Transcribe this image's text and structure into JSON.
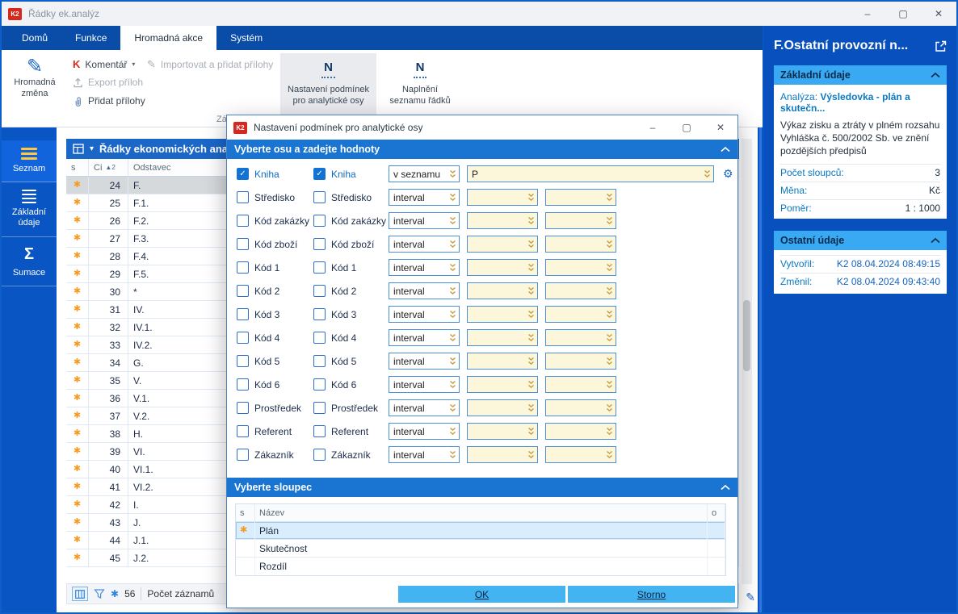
{
  "window": {
    "title": "Řádky ek.analýz",
    "controls": {
      "minimize": "–",
      "maximize": "▢",
      "close": "✕"
    }
  },
  "ribbon": {
    "tabs": [
      {
        "label": "Domů"
      },
      {
        "label": "Funkce"
      },
      {
        "label": "Hromadná akce",
        "active": true
      },
      {
        "label": "Systém"
      }
    ],
    "buttons": {
      "bulk_line1": "Hromadná",
      "bulk_line2": "změna",
      "comment_k": "K",
      "comment": "Komentář",
      "export_attachments": "Export příloh",
      "add_attachments": "Přidat přílohy",
      "import_add_attachments": "Importovat a přidat přílohy",
      "n_glyph": "N",
      "set_conditions_line1": "Nastavení podmínek",
      "set_conditions_line2": "pro analytické osy",
      "fill_rows_line1": "Naplnění",
      "fill_rows_line2": "seznamu řádků"
    },
    "group_label_partial": "Zá"
  },
  "sidebar": {
    "items": [
      {
        "label": "Seznam",
        "selected": true
      },
      {
        "label": "Základní údaje"
      },
      {
        "label": "Sumace"
      }
    ]
  },
  "grid": {
    "title": "Řádky ekonomických analýz",
    "columns": [
      "s",
      "Ci",
      "Odstavec"
    ],
    "sort_priority": "2",
    "rows": [
      {
        "ci": "24",
        "odstavec": "F.",
        "selected": true
      },
      {
        "ci": "25",
        "odstavec": "F.1."
      },
      {
        "ci": "26",
        "odstavec": "F.2."
      },
      {
        "ci": "27",
        "odstavec": "F.3."
      },
      {
        "ci": "28",
        "odstavec": "F.4."
      },
      {
        "ci": "29",
        "odstavec": "F.5."
      },
      {
        "ci": "30",
        "odstavec": "*"
      },
      {
        "ci": "31",
        "odstavec": "IV."
      },
      {
        "ci": "32",
        "odstavec": "IV.1."
      },
      {
        "ci": "33",
        "odstavec": "IV.2."
      },
      {
        "ci": "34",
        "odstavec": "G."
      },
      {
        "ci": "35",
        "odstavec": "V."
      },
      {
        "ci": "36",
        "odstavec": "V.1."
      },
      {
        "ci": "37",
        "odstavec": "V.2."
      },
      {
        "ci": "38",
        "odstavec": "H."
      },
      {
        "ci": "39",
        "odstavec": "VI."
      },
      {
        "ci": "40",
        "odstavec": "VI.1."
      },
      {
        "ci": "41",
        "odstavec": "VI.2."
      },
      {
        "ci": "42",
        "odstavec": "I."
      },
      {
        "ci": "43",
        "odstavec": "J."
      },
      {
        "ci": "44",
        "odstavec": "J.1."
      },
      {
        "ci": "45",
        "odstavec": "J.2."
      }
    ],
    "footer": {
      "count": "56",
      "count_label": "Počet záznamů"
    }
  },
  "dialog": {
    "title": "Nastavení podmínek pro analytické osy",
    "section_axes": "Vyberte osu a zadejte hodnoty",
    "section_column": "Vyberte sloupec",
    "axes": [
      {
        "label": "Kniha",
        "checked": true,
        "operator": "v seznamu",
        "value": "P",
        "wide": true
      },
      {
        "label": "Středisko",
        "checked": false,
        "operator": "interval"
      },
      {
        "label": "Kód zakázky",
        "checked": false,
        "operator": "interval"
      },
      {
        "label": "Kód zboží",
        "checked": false,
        "operator": "interval"
      },
      {
        "label": "Kód 1",
        "checked": false,
        "operator": "interval"
      },
      {
        "label": "Kód 2",
        "checked": false,
        "operator": "interval"
      },
      {
        "label": "Kód 3",
        "checked": false,
        "operator": "interval"
      },
      {
        "label": "Kód 4",
        "checked": false,
        "operator": "interval"
      },
      {
        "label": "Kód 5",
        "checked": false,
        "operator": "interval"
      },
      {
        "label": "Kód 6",
        "checked": false,
        "operator": "interval"
      },
      {
        "label": "Prostředek",
        "checked": false,
        "operator": "interval"
      },
      {
        "label": "Referent",
        "checked": false,
        "operator": "interval"
      },
      {
        "label": "Zákazník",
        "checked": false,
        "operator": "interval"
      }
    ],
    "column_table": {
      "headers": [
        "s",
        "Název",
        "o"
      ],
      "rows": [
        {
          "name": "Plán",
          "selected": true
        },
        {
          "name": "Skutečnost"
        },
        {
          "name": "Rozdíl"
        }
      ]
    },
    "ok": "OK",
    "cancel": "Storno"
  },
  "panel": {
    "title": "F.Ostatní provozní n...",
    "sections": [
      {
        "title": "Základní údaje",
        "analysis_label": "Analýza:",
        "analysis_value": "Výsledovka - plán a skutečn...",
        "description": "Výkaz zisku a ztráty v plném rozsahu Vyhláška č. 500/2002 Sb. ve znění pozdějších předpisů",
        "fields": [
          {
            "label": "Počet sloupců:",
            "value": "3"
          },
          {
            "label": "Měna:",
            "value": "Kč"
          },
          {
            "label": "Poměr:",
            "value": "1 : 1000"
          }
        ]
      },
      {
        "title": "Ostatní údaje",
        "fields": [
          {
            "label": "Vytvořil:",
            "value": "K2 08.04.2024 08:49:15"
          },
          {
            "label": "Změnil:",
            "value": "K2 08.04.2024 09:43:40"
          }
        ]
      }
    ]
  },
  "colors": {
    "accent_blue": "#0a55c4",
    "ribbon_bar": "#0a4da8",
    "grid_header": "#1a67c8",
    "dialog_section_header": "#1a75d2",
    "panel_section_header": "#38a9f2",
    "field_cream": "#fcf6da",
    "star_orange": "#f59b22",
    "button_cyan": "#43b3f2",
    "label_teal": "#0b79c2",
    "value_blue": "#1565c0",
    "logo_red": "#d5281e"
  }
}
